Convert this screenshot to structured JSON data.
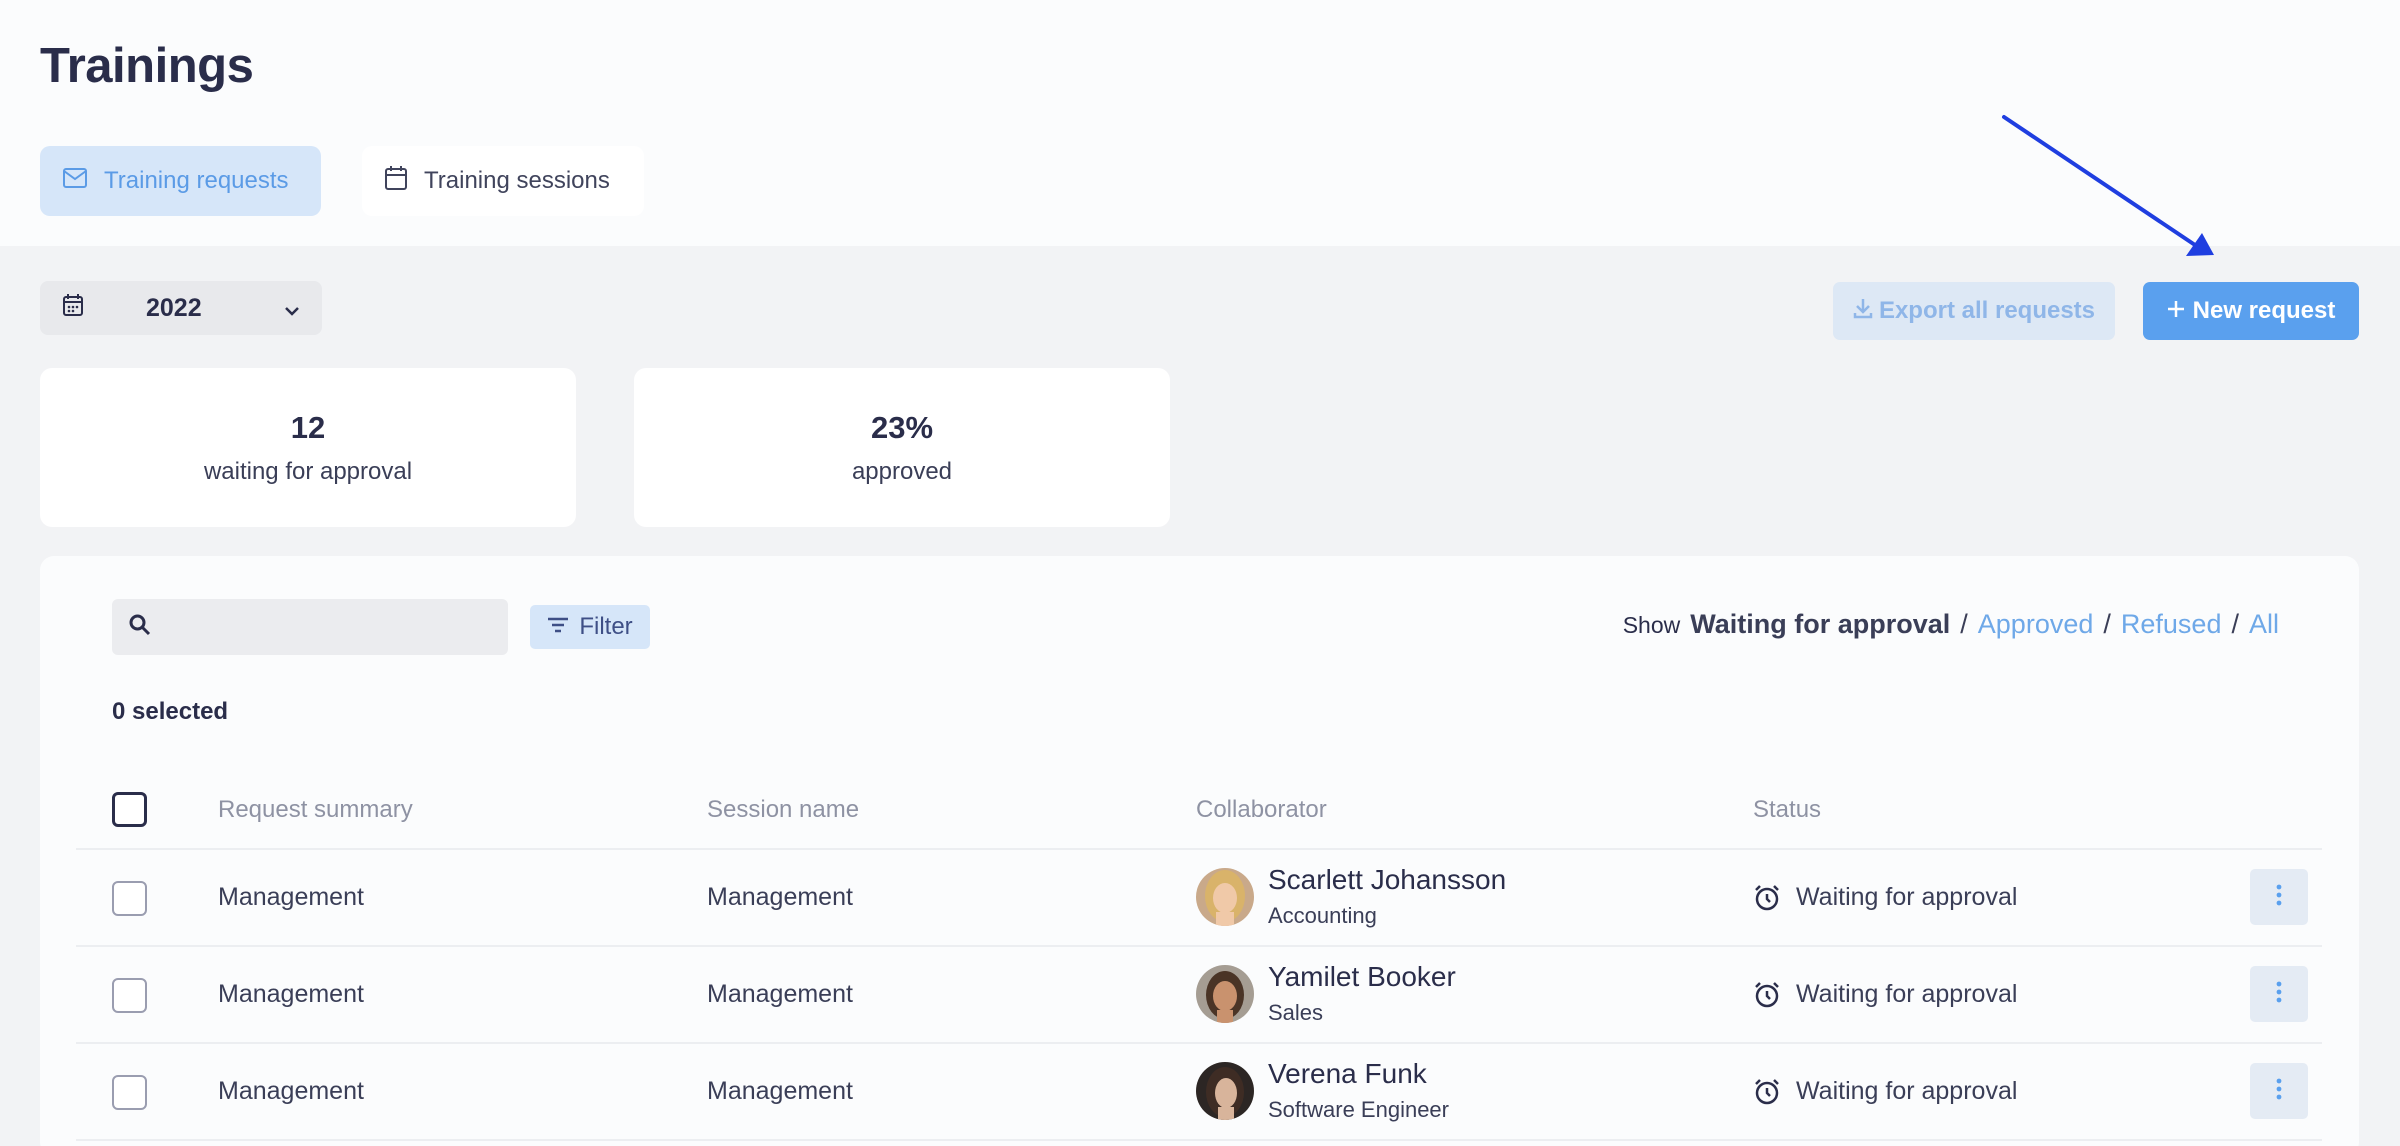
{
  "page": {
    "title": "Trainings"
  },
  "tabs": [
    {
      "label": "Training requests",
      "icon": "mail-icon",
      "active": true
    },
    {
      "label": "Training sessions",
      "icon": "calendar-icon",
      "active": false
    }
  ],
  "toolbar": {
    "year": "2022",
    "export_label": "Export all requests",
    "new_label": "New request"
  },
  "stats": [
    {
      "value": "12",
      "label": "waiting for approval"
    },
    {
      "value": "23%",
      "label": "approved"
    }
  ],
  "search": {
    "placeholder": ""
  },
  "filter_label": "Filter",
  "show": {
    "label": "Show",
    "active": "Waiting for approval",
    "options": [
      "Approved",
      "Refused",
      "All"
    ],
    "separator": "/"
  },
  "selected_count": "0 selected",
  "table": {
    "headers": [
      "Request summary",
      "Session name",
      "Collaborator",
      "Status"
    ],
    "rows": [
      {
        "summary": "Management",
        "session": "Management",
        "name": "Scarlett Johansson",
        "dept": "Accounting",
        "status": "Waiting for approval"
      },
      {
        "summary": "Management",
        "session": "Management",
        "name": "Yamilet Booker",
        "dept": "Sales",
        "status": "Waiting for approval"
      },
      {
        "summary": "Management",
        "session": "Management",
        "name": "Verena Funk",
        "dept": "Software Engineer",
        "status": "Waiting for approval"
      }
    ]
  },
  "colors": {
    "accent": "#5aa0ee",
    "tab_active_bg": "#d6e6f9",
    "annotation_arrow": "#1f3ee0"
  }
}
